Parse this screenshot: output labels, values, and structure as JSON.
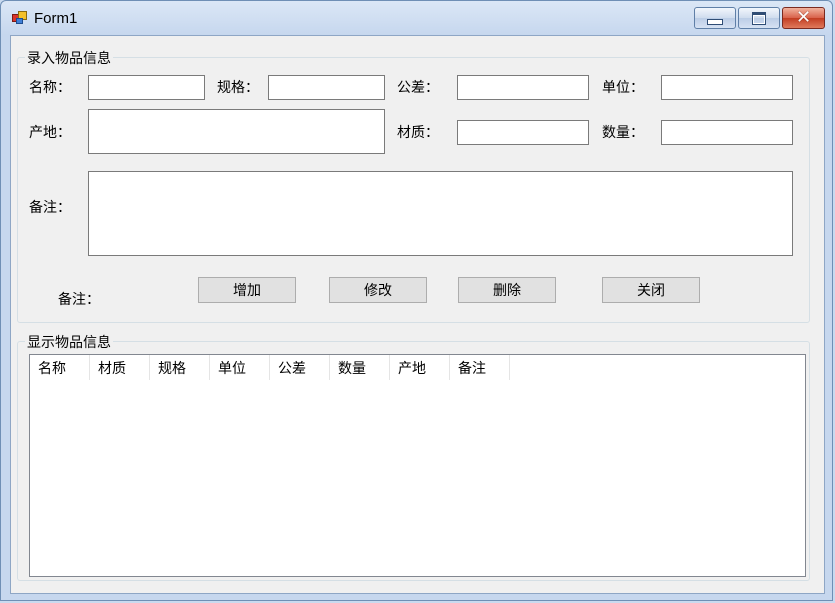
{
  "window": {
    "title": "Form1"
  },
  "entry_group": {
    "title": "录入物品信息",
    "labels": {
      "name": "名称：",
      "spec": "规格：",
      "tolerance": "公差：",
      "unit": "单位：",
      "origin": "产地：",
      "material": "材质：",
      "quantity": "数量：",
      "remarks": "备注：",
      "remarks2": "备注："
    },
    "values": {
      "name": "",
      "spec": "",
      "tolerance": "",
      "unit": "",
      "origin": "",
      "material": "",
      "quantity": "",
      "remarks": ""
    },
    "buttons": {
      "add": "增加",
      "modify": "修改",
      "delete": "删除",
      "close": "关闭"
    }
  },
  "display_group": {
    "title": "显示物品信息",
    "columns": [
      "名称",
      "材质",
      "规格",
      "单位",
      "公差",
      "数量",
      "产地",
      "备注"
    ],
    "rows": []
  },
  "icons": {
    "app": "form-app-icon",
    "minimize": "minimize-icon",
    "maximize": "maximize-icon",
    "close": "close-icon"
  }
}
